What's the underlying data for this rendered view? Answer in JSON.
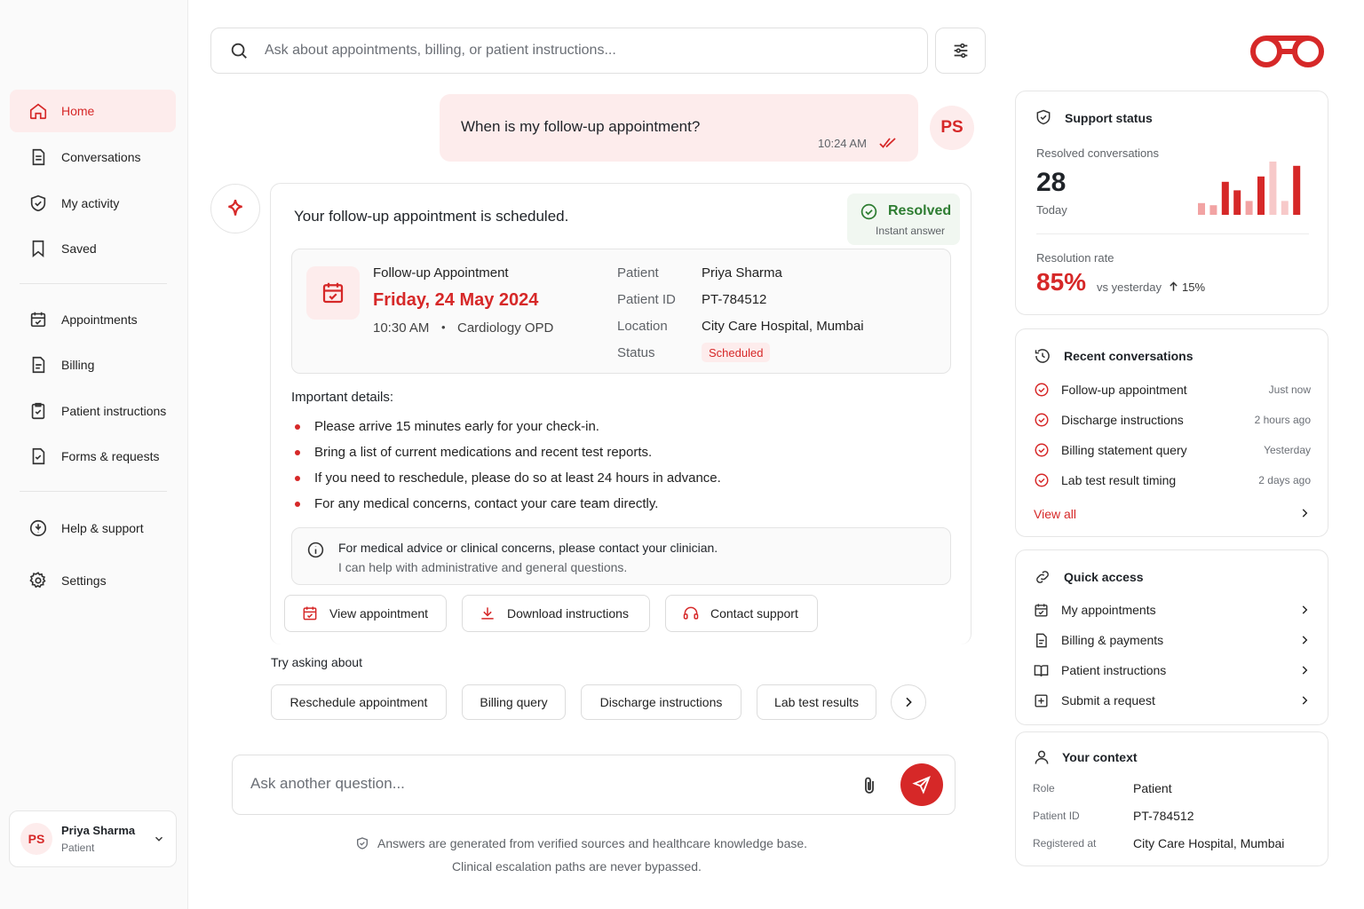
{
  "sidebar": {
    "nav": [
      {
        "label": "Home",
        "icon": "home-icon"
      },
      {
        "label": "Conversations",
        "icon": "document-icon"
      },
      {
        "label": "My activity",
        "icon": "shield-check-icon"
      },
      {
        "label": "Saved",
        "icon": "bookmark-icon"
      },
      {
        "label": "Appointments",
        "icon": "calendar-icon"
      },
      {
        "label": "Billing",
        "icon": "file-icon"
      },
      {
        "label": "Patient instructions",
        "icon": "clipboard-icon"
      },
      {
        "label": "Forms & requests",
        "icon": "form-icon"
      },
      {
        "label": "Help & support",
        "icon": "help-icon"
      },
      {
        "label": "Settings",
        "icon": "gear-icon"
      }
    ],
    "user": {
      "initials": "PS",
      "name": "Priya Sharma",
      "role": "Patient"
    }
  },
  "search": {
    "placeholder": "Ask about appointments, billing, or patient instructions..."
  },
  "user_message": {
    "text": "When is my follow-up appointment?",
    "time": "10:24 AM",
    "initials": "PS"
  },
  "bot_message": {
    "headline": "Your follow-up appointment is scheduled.",
    "badge": {
      "title": "Resolved",
      "subtitle": "Instant answer"
    },
    "appointment": {
      "title": "Follow-up Appointment",
      "date": "Friday, 24 May 2024",
      "time": "10:30 AM",
      "separator": "•",
      "department": "Cardiology OPD",
      "fields": [
        {
          "label": "Patient",
          "value": "Priya Sharma"
        },
        {
          "label": "Patient ID",
          "value": "PT-784512"
        },
        {
          "label": "Location",
          "value": "City Care Hospital, Mumbai"
        },
        {
          "label": "Status",
          "value": "Scheduled"
        }
      ]
    },
    "details_heading": "Important details:",
    "details": [
      "Please arrive 15 minutes early for your check-in.",
      "Bring a list of current medications and recent test reports.",
      "If you need to reschedule, please do so at least 24 hours in advance.",
      "For any medical concerns, contact your care team directly."
    ],
    "notice": {
      "title": "For medical advice or clinical concerns, please contact your clinician.",
      "body": "I can help with administrative and general questions."
    },
    "actions": [
      "View appointment",
      "Download instructions",
      "Contact support"
    ]
  },
  "suggestions": {
    "heading": "Try asking about",
    "chips": [
      "Reschedule appointment",
      "Billing query",
      "Discharge instructions",
      "Lab test results"
    ]
  },
  "composer": {
    "placeholder": "Ask another question..."
  },
  "footer": {
    "line1": "Answers are generated from verified sources and healthcare knowledge base.",
    "line2": "Clinical escalation paths are never bypassed."
  },
  "support_status": {
    "title": "Support status",
    "resolved_label": "Resolved conversations",
    "resolved_count": "28",
    "resolved_period": "Today",
    "rate_label": "Resolution rate",
    "rate_value": "85%",
    "rate_compare": "vs yesterday",
    "rate_delta": "15%",
    "bars": [
      0.22,
      0.18,
      0.62,
      0.46,
      0.26,
      0.72,
      1.0,
      0.26,
      0.92
    ],
    "bar_colors": [
      "#f2a3a3",
      "#f2a3a3",
      "#d62828",
      "#d62828",
      "#f2a3a3",
      "#d62828",
      "#f7c9c9",
      "#f7c9c9",
      "#d62828"
    ]
  },
  "recent": {
    "title": "Recent conversations",
    "items": [
      {
        "label": "Follow-up appointment",
        "time": "Just now"
      },
      {
        "label": "Discharge instructions",
        "time": "2 hours ago"
      },
      {
        "label": "Billing statement query",
        "time": "Yesterday"
      },
      {
        "label": "Lab test result timing",
        "time": "2 days ago"
      }
    ],
    "view_all": "View all"
  },
  "quick_access": {
    "title": "Quick access",
    "items": [
      "My appointments",
      "Billing & payments",
      "Patient instructions",
      "Submit a request"
    ]
  },
  "context": {
    "title": "Your context",
    "rows": [
      {
        "label": "Role",
        "value": "Patient"
      },
      {
        "label": "Patient ID",
        "value": "PT-784512"
      },
      {
        "label": "Registered at",
        "value": "City Care Hospital, Mumbai"
      }
    ]
  },
  "colors": {
    "accent": "#d62828",
    "accent_soft": "#fdecec",
    "success": "#2e7d32"
  }
}
